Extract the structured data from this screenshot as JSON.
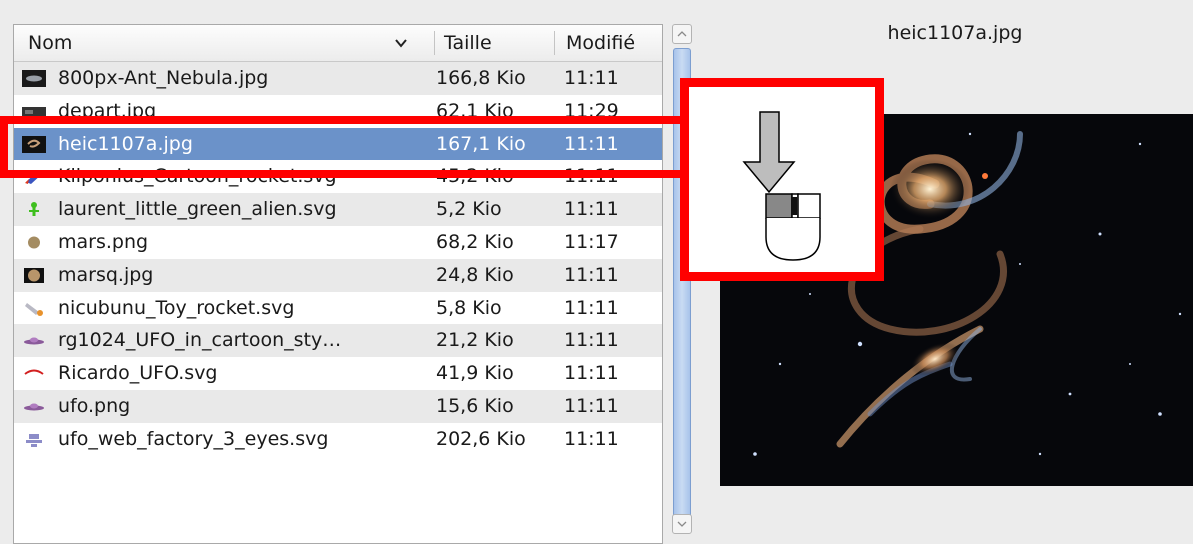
{
  "file_list": {
    "columns": {
      "name": "Nom",
      "size": "Taille",
      "modified": "Modifié"
    },
    "sort_indicator_icon": "chevron-down-icon",
    "selected_index": 2,
    "rows": [
      {
        "name": "800px-Ant_Nebula.jpg",
        "size": "166,8 Kio",
        "modified": "11:11",
        "icon": "nebula-thumbnail-icon"
      },
      {
        "name": "depart.jpg",
        "size": "62,1 Kio",
        "modified": "11:29",
        "icon": "image-thumbnail-icon"
      },
      {
        "name": "heic1107a.jpg",
        "size": "167,1 Kio",
        "modified": "11:11",
        "icon": "galaxy-thumbnail-icon"
      },
      {
        "name": "Kliponius_Cartoon_rocket.svg",
        "size": "45,2 Kio",
        "modified": "11:11",
        "icon": "rocket-icon"
      },
      {
        "name": "laurent_little_green_alien.svg",
        "size": "5,2 Kio",
        "modified": "11:11",
        "icon": "green-alien-icon"
      },
      {
        "name": "mars.png",
        "size": "68,2 Kio",
        "modified": "11:17",
        "icon": "planet-icon"
      },
      {
        "name": "marsq.jpg",
        "size": "24,8 Kio",
        "modified": "11:11",
        "icon": "planet-square-icon"
      },
      {
        "name": "nicubunu_Toy_rocket.svg",
        "size": "5,8 Kio",
        "modified": "11:11",
        "icon": "toy-rocket-icon"
      },
      {
        "name": "rg1024_UFO_in_cartoon_sty…",
        "size": "21,2 Kio",
        "modified": "11:11",
        "icon": "ufo-icon"
      },
      {
        "name": "Ricardo_UFO.svg",
        "size": "41,9 Kio",
        "modified": "11:11",
        "icon": "ufo-red-icon"
      },
      {
        "name": "ufo.png",
        "size": "15,6 Kio",
        "modified": "11:11",
        "icon": "ufo-icon"
      },
      {
        "name": "ufo_web_factory_3_eyes.svg",
        "size": "202,6 Kio",
        "modified": "11:11",
        "icon": "ufo-robot-icon"
      }
    ]
  },
  "preview": {
    "title": "heic1107a.jpg",
    "image_icon": "galaxy-preview-image"
  },
  "annotations": {
    "highlight_color": "#ff0000",
    "cursor_icon": "mouse-left-click-down-icon"
  },
  "colors": {
    "selection": "#6b92c9",
    "alt_row": "#e9e9e9",
    "background": "#ececec"
  }
}
